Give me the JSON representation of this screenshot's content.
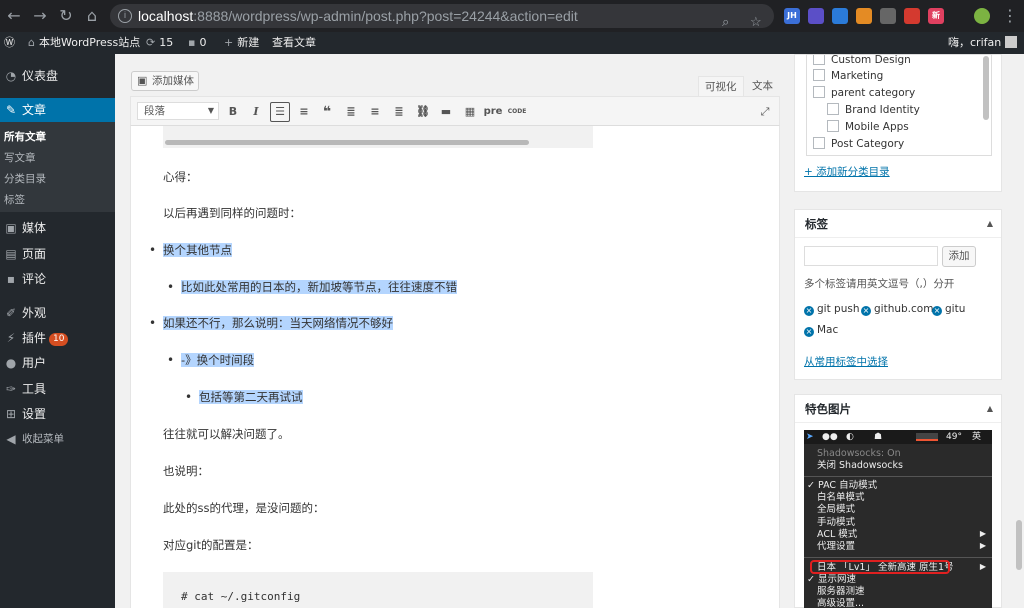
{
  "browser": {
    "url_host": "localhost",
    "url_path": ":8888/wordpress/wp-admin/post.php?post=24244&action=edit",
    "extensions": [
      "JH",
      "新"
    ]
  },
  "admin_bar": {
    "site_name": "本地WordPress站点",
    "updates": "15",
    "comments": "0",
    "new": "新建",
    "view_post": "查看文章",
    "greeting": "嗨，crifan"
  },
  "menu": {
    "dashboard": "仪表盘",
    "posts": "文章",
    "posts_sub": [
      "所有文章",
      "写文章",
      "分类目录",
      "标签"
    ],
    "media": "媒体",
    "pages": "页面",
    "comments": "评论",
    "appearance": "外观",
    "plugins": "插件",
    "plugins_badge": "10",
    "users": "用户",
    "tools": "工具",
    "settings": "设置",
    "collapse": "收起菜单"
  },
  "editor": {
    "add_media": "添加媒体",
    "tab_visual": "可视化",
    "tab_text": "文本",
    "format": "段落",
    "toolbar_pre": "pre",
    "toolbar_code": "CODE",
    "content": {
      "p1": "心得：",
      "p2": "以后再遇到同样的问题时：",
      "b1": "换个其他节点",
      "b1_1": "比如此处常用的日本的，新加坡等节点，往往速度不错",
      "b2": "如果还不行，那么说明：当天网络情况不够好",
      "b2_1": "-》换个时间段",
      "b2_1_1": "包括等第二天再试试",
      "p3": "往往就可以解决问题了。",
      "p4": "也说明：",
      "p5": "此处的ss的代理，是没问题的：",
      "p6": "对应git的配置是：",
      "code": "# cat ~/.gitconfig"
    }
  },
  "categories": {
    "items": [
      "Custom Design",
      "Marketing",
      "parent category",
      "Brand Identity",
      "Mobile Apps",
      "Post Category"
    ],
    "add_new": "+ 添加新分类目录"
  },
  "tags_box": {
    "title": "标签",
    "add_button": "添加",
    "hint": "多个标签请用英文逗号（,）分开",
    "tags": [
      "git push",
      "github.com",
      "gitu",
      "Mac"
    ],
    "choose_link": "从常用标签中选择"
  },
  "featured": {
    "title": "特色图片",
    "menubar_temp": "49°",
    "menubar_lang": "英",
    "menu": {
      "status": "Shadowsocks: On",
      "close": "关闭 Shadowsocks",
      "pac": "✓ PAC 自动模式",
      "whitelist": "白名单模式",
      "global": "全局模式",
      "manual": "手动模式",
      "acl": "ACL 模式",
      "proxy": "代理设置",
      "server": "日本 「Lv1」 全新高速 原生1号",
      "show_speed": "✓ 显示网速",
      "server_test": "服务器测速",
      "advanced": "高级设置..."
    }
  }
}
